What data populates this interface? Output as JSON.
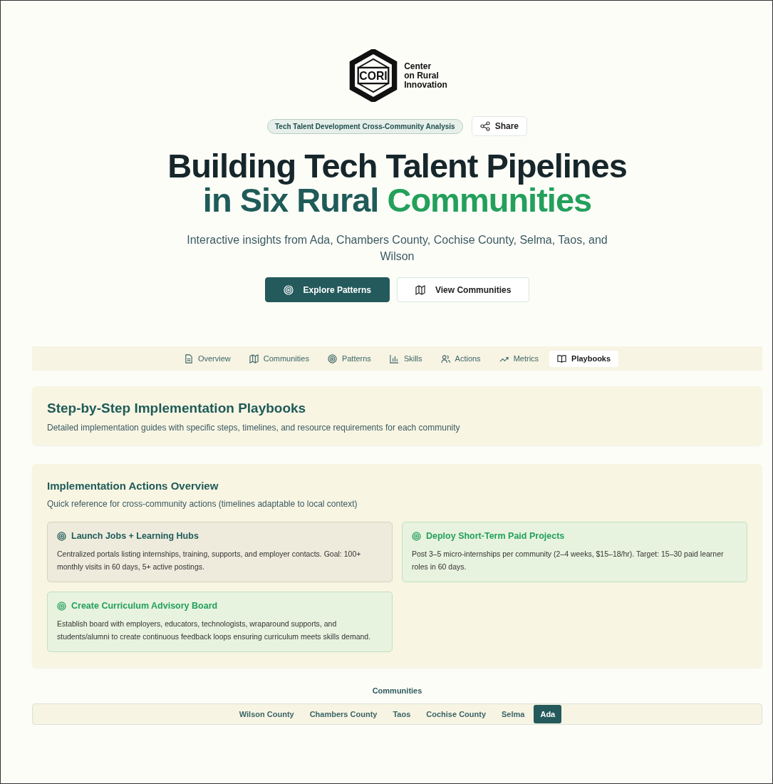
{
  "logo": {
    "mark": "CORI",
    "name_lines": [
      "Center",
      "on Rural",
      "Innovation"
    ]
  },
  "badge": "Tech Talent Development Cross-Community Analysis",
  "share_button": "Share",
  "title": {
    "line_1": "Building Tech Talent Pipelines",
    "line_2_start": "in Six Rural ",
    "line_2_end": "Communities"
  },
  "subtitle": "Interactive insights from Ada, Chambers County, Cochise County, Selma, Taos, and Wilson",
  "hero_buttons": [
    {
      "label": "Explore Patterns",
      "kind": "primary"
    },
    {
      "label": "View Communities",
      "kind": "secondary"
    }
  ],
  "tabs": [
    {
      "label": "Overview",
      "kind": "document",
      "selected": false
    },
    {
      "label": "Communities",
      "kind": "map",
      "selected": false
    },
    {
      "label": "Patterns",
      "kind": "target",
      "selected": false
    },
    {
      "label": "Skills",
      "kind": "bars",
      "selected": false
    },
    {
      "label": "Actions",
      "kind": "people",
      "selected": false
    },
    {
      "label": "Metrics",
      "kind": "trend",
      "selected": false
    },
    {
      "label": "Playbooks",
      "kind": "book",
      "selected": true
    }
  ],
  "intro": {
    "title": "Step-by-Step Implementation Playbooks",
    "text": "Detailed implementation guides with specific steps, timelines, and resource requirements for each community"
  },
  "overview": {
    "title": "Implementation Actions Overview",
    "text": "Quick reference for cross-community actions (timelines adaptable to local context)",
    "actions": [
      {
        "kind": "neutral",
        "title": "Launch Jobs + Learning Hubs",
        "text": "Centralized portals listing internships, training, supports, and employer contacts. Goal: 100+ monthly visits in 60 days, 5+ active postings."
      },
      {
        "kind": "green",
        "title": "Deploy Short-Term Paid Projects",
        "text": "Post 3–5 micro-internships per community (2–4 weeks, $15–18/hr). Target: 15–30 paid learner roles in 60 days."
      },
      {
        "kind": "green",
        "title": "Create Curriculum Advisory Board",
        "text": "Establish board with employers, educators, technologists, wraparound supports, and students/alumni to create continuous feedback loops ensuring curriculum meets skills demand."
      }
    ]
  },
  "communities": {
    "label": "Communities",
    "tabs": [
      {
        "label": "Wilson County",
        "selected": false
      },
      {
        "label": "Chambers County",
        "selected": false
      },
      {
        "label": "Taos",
        "selected": false
      },
      {
        "label": "Cochise County",
        "selected": false
      },
      {
        "label": "Selma",
        "selected": false
      },
      {
        "label": "Ada",
        "selected": true
      }
    ]
  }
}
